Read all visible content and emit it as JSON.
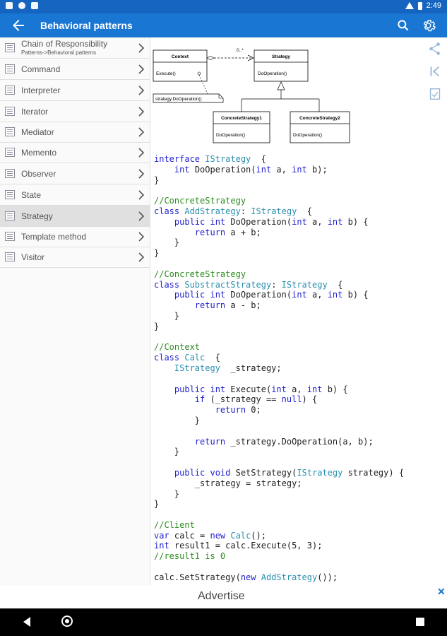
{
  "status": {
    "time": "2:49"
  },
  "appbar": {
    "title": "Behavioral patterns"
  },
  "sidebar": {
    "items": [
      {
        "label": "Chain of Responsibility",
        "sub": "Patterns->Behavioral patterns"
      },
      {
        "label": "Command"
      },
      {
        "label": "Interpreter"
      },
      {
        "label": "Iterator"
      },
      {
        "label": "Mediator"
      },
      {
        "label": "Memento"
      },
      {
        "label": "Observer"
      },
      {
        "label": "State"
      },
      {
        "label": "Strategy",
        "selected": true
      },
      {
        "label": "Template method"
      },
      {
        "label": "Visitor"
      }
    ]
  },
  "diagram": {
    "context": {
      "name": "Context",
      "method": "Execute()"
    },
    "strategy": {
      "name": "Strategy",
      "method": "DoOperation()"
    },
    "concrete1": {
      "name": "ConcreteStrategy1",
      "method": "DoOperation()"
    },
    "concrete2": {
      "name": "ConcreteStrategy2",
      "method": "DoOperation()"
    },
    "note": "strategy.DoOperation()",
    "multiplicity": "0..*"
  },
  "code_lines": [
    [
      [
        "kw",
        "interface "
      ],
      [
        "ty",
        "IStrategy"
      ],
      [
        "",
        "  {"
      ]
    ],
    [
      [
        "",
        "    "
      ],
      [
        "kw",
        "int "
      ],
      [
        "",
        "DoOperation("
      ],
      [
        "kw",
        "int "
      ],
      [
        "",
        "a, "
      ],
      [
        "kw",
        "int "
      ],
      [
        "",
        "b);"
      ]
    ],
    [
      [
        "",
        "}"
      ]
    ],
    [
      [
        "",
        ""
      ]
    ],
    [
      [
        "cm",
        "//ConcreteStrategy"
      ]
    ],
    [
      [
        "kw",
        "class "
      ],
      [
        "ty",
        "AddStrategy"
      ],
      [
        "",
        ": "
      ],
      [
        "ty",
        "IStrategy"
      ],
      [
        "",
        "  {"
      ]
    ],
    [
      [
        "",
        "    "
      ],
      [
        "kw",
        "public int "
      ],
      [
        "",
        "DoOperation("
      ],
      [
        "kw",
        "int "
      ],
      [
        "",
        "a, "
      ],
      [
        "kw",
        "int "
      ],
      [
        "",
        "b) {"
      ]
    ],
    [
      [
        "",
        "        "
      ],
      [
        "kw",
        "return "
      ],
      [
        "",
        "a + b;"
      ]
    ],
    [
      [
        "",
        "    }"
      ]
    ],
    [
      [
        "",
        "}"
      ]
    ],
    [
      [
        "",
        ""
      ]
    ],
    [
      [
        "cm",
        "//ConcreteStrategy"
      ]
    ],
    [
      [
        "kw",
        "class "
      ],
      [
        "ty",
        "SubstractStrategy"
      ],
      [
        "",
        ": "
      ],
      [
        "ty",
        "IStrategy"
      ],
      [
        "",
        "  {"
      ]
    ],
    [
      [
        "",
        "    "
      ],
      [
        "kw",
        "public int "
      ],
      [
        "",
        "DoOperation("
      ],
      [
        "kw",
        "int "
      ],
      [
        "",
        "a, "
      ],
      [
        "kw",
        "int "
      ],
      [
        "",
        "b) {"
      ]
    ],
    [
      [
        "",
        "        "
      ],
      [
        "kw",
        "return "
      ],
      [
        "",
        "a - b;"
      ]
    ],
    [
      [
        "",
        "    }"
      ]
    ],
    [
      [
        "",
        "}"
      ]
    ],
    [
      [
        "",
        ""
      ]
    ],
    [
      [
        "cm",
        "//Context"
      ]
    ],
    [
      [
        "kw",
        "class "
      ],
      [
        "ty",
        "Calc"
      ],
      [
        "",
        "  {"
      ]
    ],
    [
      [
        "",
        "    "
      ],
      [
        "ty",
        "IStrategy"
      ],
      [
        "",
        "  _strategy;"
      ]
    ],
    [
      [
        "",
        ""
      ]
    ],
    [
      [
        "",
        "    "
      ],
      [
        "kw",
        "public int "
      ],
      [
        "",
        "Execute("
      ],
      [
        "kw",
        "int "
      ],
      [
        "",
        "a, "
      ],
      [
        "kw",
        "int "
      ],
      [
        "",
        "b) {"
      ]
    ],
    [
      [
        "",
        "        "
      ],
      [
        "kw",
        "if "
      ],
      [
        "",
        "(_strategy == "
      ],
      [
        "kw",
        "null"
      ],
      [
        "",
        ") {"
      ]
    ],
    [
      [
        "",
        "            "
      ],
      [
        "kw",
        "return "
      ],
      [
        "",
        "0;"
      ]
    ],
    [
      [
        "",
        "        }"
      ]
    ],
    [
      [
        "",
        ""
      ]
    ],
    [
      [
        "",
        "        "
      ],
      [
        "kw",
        "return "
      ],
      [
        "",
        "_strategy.DoOperation(a, b);"
      ]
    ],
    [
      [
        "",
        "    }"
      ]
    ],
    [
      [
        "",
        ""
      ]
    ],
    [
      [
        "",
        "    "
      ],
      [
        "kw",
        "public void "
      ],
      [
        "",
        "SetStrategy("
      ],
      [
        "ty",
        "IStrategy"
      ],
      [
        "",
        " strategy) {"
      ]
    ],
    [
      [
        "",
        "        _strategy = strategy;"
      ]
    ],
    [
      [
        "",
        "    }"
      ]
    ],
    [
      [
        "",
        "}"
      ]
    ],
    [
      [
        "",
        ""
      ]
    ],
    [
      [
        "cm",
        "//Client"
      ]
    ],
    [
      [
        "kw",
        "var "
      ],
      [
        "",
        "calc = "
      ],
      [
        "kw",
        "new "
      ],
      [
        "ty",
        "Calc"
      ],
      [
        "",
        "();"
      ]
    ],
    [
      [
        "kw",
        "int "
      ],
      [
        "",
        "result1 = calc.Execute(5, 3);"
      ]
    ],
    [
      [
        "cm",
        "//result1 is 0"
      ]
    ],
    [
      [
        "",
        ""
      ]
    ],
    [
      [
        "",
        "calc.SetStrategy("
      ],
      [
        "kw",
        "new "
      ],
      [
        "ty",
        "AddStrategy"
      ],
      [
        "",
        "());"
      ]
    ]
  ],
  "ad": {
    "text": "Advertise",
    "close": "✕"
  },
  "colors": {
    "statusbar": "#1565c0",
    "appbar": "#1976d2",
    "keyword": "#2323d0",
    "type": "#2b8fb0",
    "comment": "#2e8b20"
  }
}
